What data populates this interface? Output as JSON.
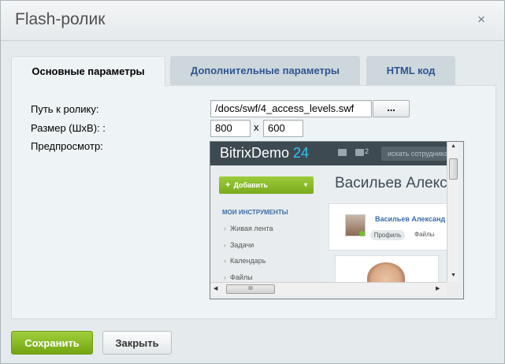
{
  "dialog": {
    "title": "Flash-ролик",
    "close_icon": "close-icon",
    "close_glyph": "×"
  },
  "tabs": [
    {
      "label": "Основные параметры",
      "active": true
    },
    {
      "label": "Дополнительные параметры",
      "active": false
    },
    {
      "label": "HTML код",
      "active": false
    }
  ],
  "form": {
    "path_label": "Путь к ролику:",
    "path_value": "/docs/swf/4_access_levels.swf",
    "browse_label": "...",
    "size_label": "Размер (ШxВ): :",
    "width_value": "800",
    "size_separator": "x",
    "height_value": "600",
    "preview_label": "Предпросмотр:"
  },
  "preview": {
    "logo_text": "BitrixDemo",
    "logo_num": "24",
    "header_count": "2",
    "search_placeholder": "искать сотрудника",
    "add_button": "Добавить",
    "add_plus": "+",
    "add_arrow": "▾",
    "section_title": "МОИ ИНСТРУМЕНТЫ",
    "menu_items": [
      "Живая лента",
      "Задачи",
      "Календарь",
      "Файлы"
    ],
    "profile_heading": "Васильев Алекс",
    "card_name": "Васильев Александ",
    "profile_tab": "Профиль",
    "files_tab": "Файлы",
    "hscroll_grip": "III"
  },
  "footer": {
    "save_label": "Сохранить",
    "close_label": "Закрыть"
  },
  "colors": {
    "accent_green": "#8bbf26",
    "tab_link": "#2f5590",
    "dialog_bg": "#e5eaec"
  }
}
